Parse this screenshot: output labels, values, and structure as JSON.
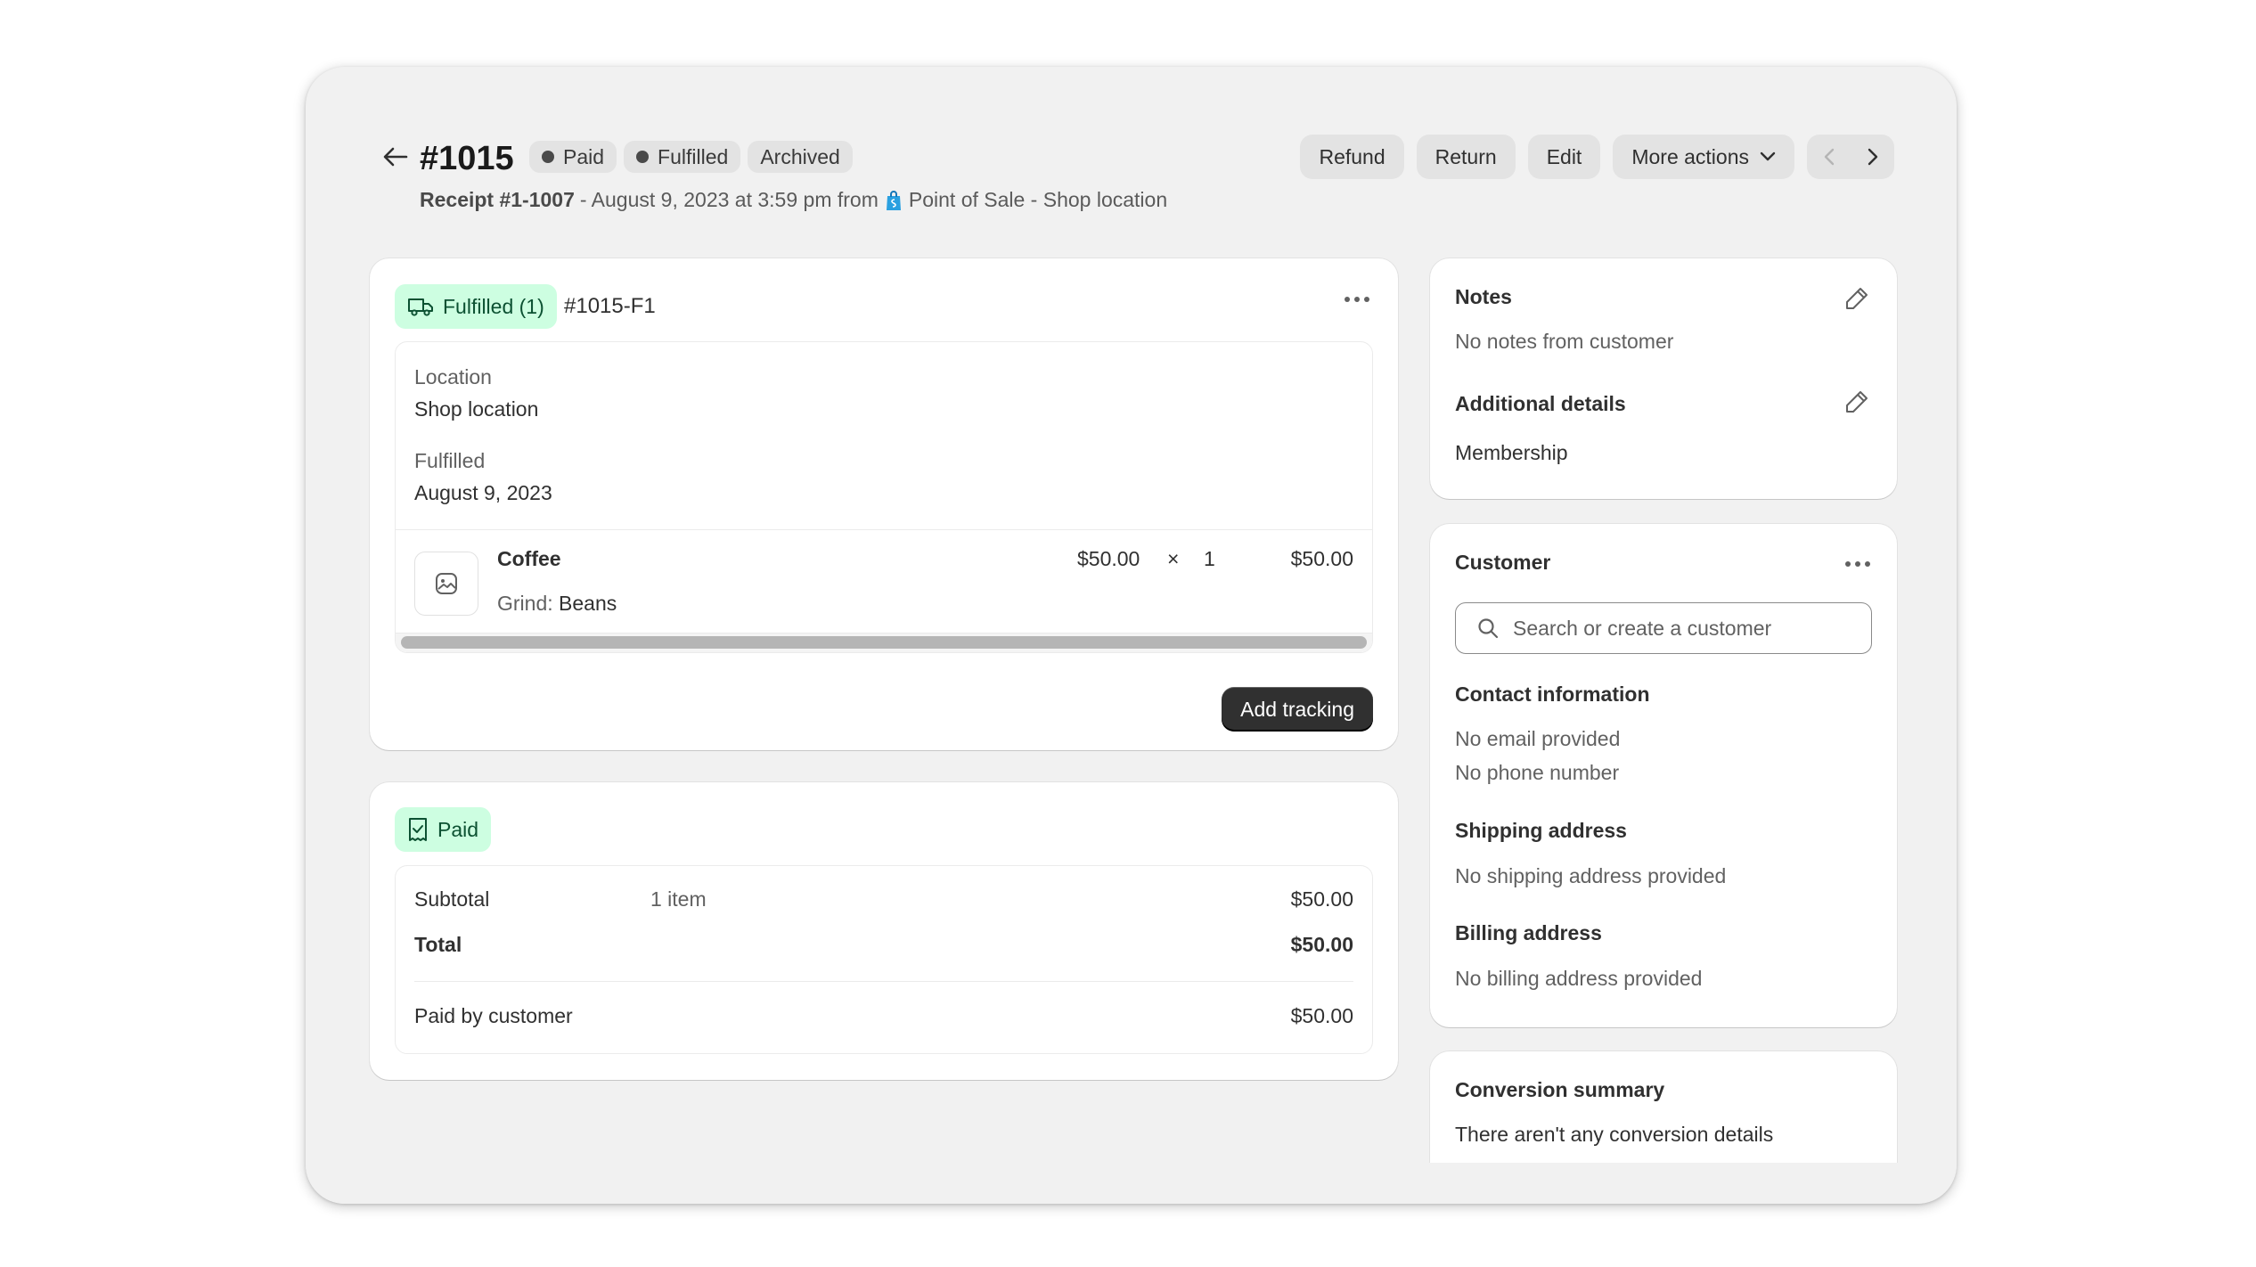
{
  "header": {
    "order_number": "#1015",
    "badges": [
      {
        "label": "Paid",
        "dot": true
      },
      {
        "label": "Fulfilled",
        "dot": true
      },
      {
        "label": "Archived",
        "dot": false
      }
    ],
    "receipt": "Receipt #1-1007",
    "sub_text": "- August 9, 2023 at 3:59 pm from",
    "channel": "Point of Sale - Shop location",
    "actions": {
      "refund": "Refund",
      "return": "Return",
      "edit": "Edit",
      "more": "More actions"
    }
  },
  "fulfillment": {
    "status_label": "Fulfilled (1)",
    "id": "#1015-F1",
    "location_label": "Location",
    "location_value": "Shop location",
    "fulfilled_label": "Fulfilled",
    "fulfilled_value": "August 9, 2023",
    "item": {
      "name": "Coffee",
      "variant_label": "Grind:",
      "variant_value": "Beans",
      "unit_price": "$50.00",
      "times": "×",
      "quantity": "1",
      "total": "$50.00"
    },
    "add_tracking": "Add tracking"
  },
  "payment": {
    "status_label": "Paid",
    "subtotal_label": "Subtotal",
    "subtotal_items": "1 item",
    "subtotal_value": "$50.00",
    "total_label": "Total",
    "total_value": "$50.00",
    "paid_label": "Paid by customer",
    "paid_value": "$50.00"
  },
  "notes": {
    "title": "Notes",
    "text": "No notes from customer",
    "additional_title": "Additional details",
    "additional_text": "Membership"
  },
  "customer": {
    "title": "Customer",
    "search_placeholder": "Search or create a customer",
    "contact_title": "Contact information",
    "email": "No email provided",
    "phone": "No phone number",
    "shipping_title": "Shipping address",
    "shipping_text": "No shipping address provided",
    "billing_title": "Billing address",
    "billing_text": "No billing address provided"
  },
  "conversion": {
    "title": "Conversion summary",
    "text": "There aren't any conversion details"
  },
  "colors": {
    "success_bg": "#cdfee1",
    "success_text": "#0c5132",
    "primary_button": "#303030",
    "surface": "#f1f1f1"
  }
}
